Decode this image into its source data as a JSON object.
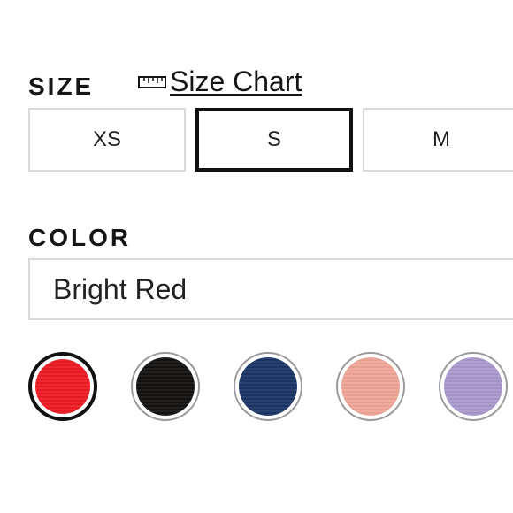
{
  "size": {
    "label": "SIZE",
    "size_chart_label": "Size Chart",
    "size_chart_icon": "ruler-icon",
    "options": [
      "XS",
      "S",
      "M"
    ],
    "selected": "S"
  },
  "color": {
    "label": "COLOR",
    "selected_name": "Bright Red",
    "swatches": [
      {
        "name": "bright-red",
        "hex": "#ee1c24",
        "selected": true
      },
      {
        "name": "black",
        "hex": "#141111",
        "selected": false
      },
      {
        "name": "navy",
        "hex": "#1b3566",
        "selected": false
      },
      {
        "name": "peach",
        "hex": "#efa598",
        "selected": false
      },
      {
        "name": "lavender",
        "hex": "#a999cc",
        "selected": false
      }
    ]
  },
  "colors": {
    "text": "#151515",
    "border": "#d9d9d9",
    "selected_border": "#111111"
  }
}
